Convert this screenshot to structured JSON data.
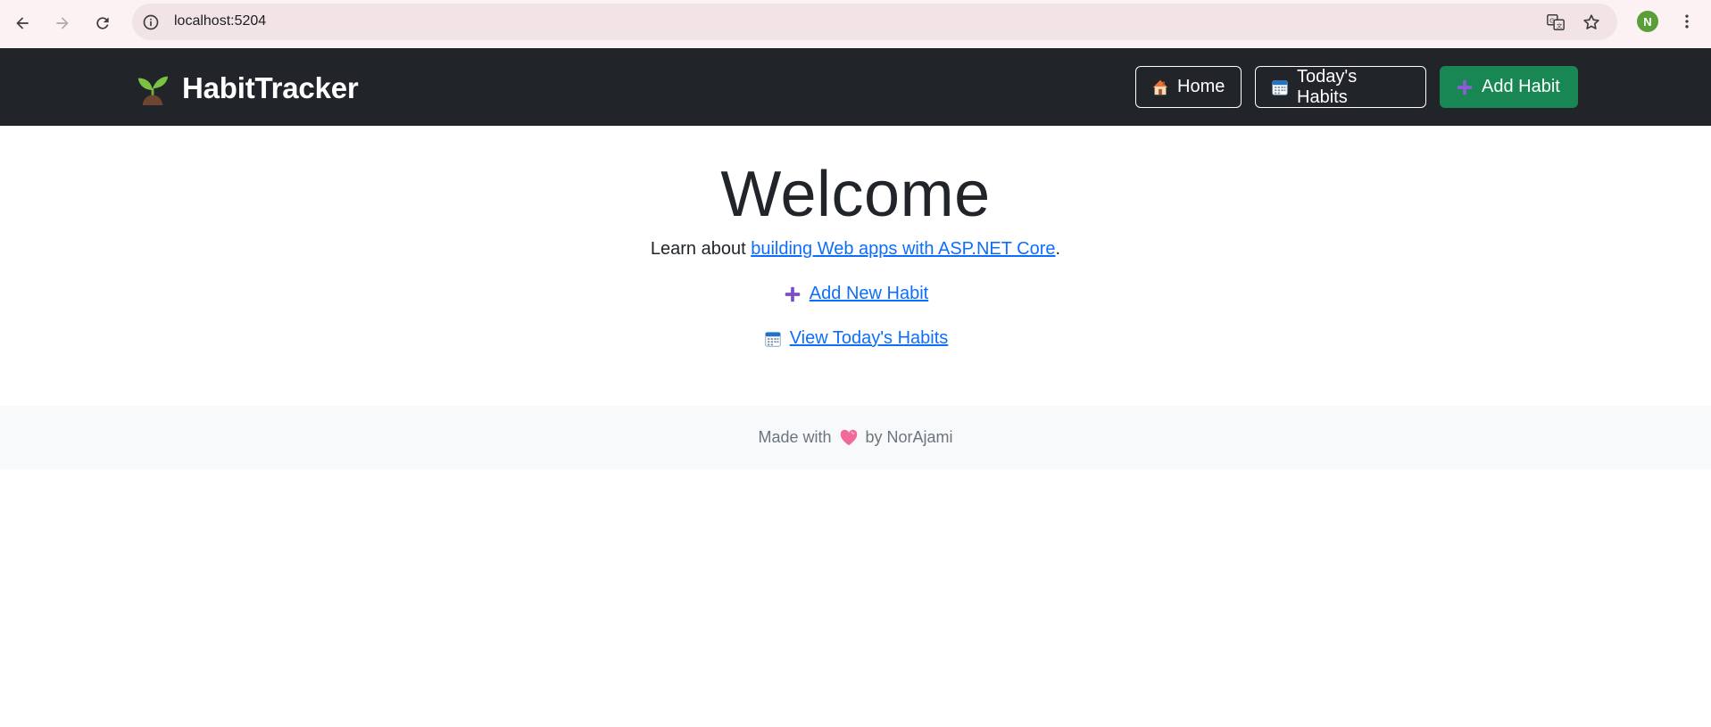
{
  "browser": {
    "url": "localhost:5204"
  },
  "navbar": {
    "brand": "HabitTracker",
    "buttons": {
      "home": "Home",
      "today": "Today's Habits",
      "add": "Add Habit"
    }
  },
  "main": {
    "title": "Welcome",
    "learn_prefix": "Learn about ",
    "learn_link": "building Web apps with ASP.NET Core",
    "learn_suffix": ".",
    "add_new_habit": "Add New Habit",
    "view_today": "View Today's Habits"
  },
  "footer": {
    "prefix": "Made with",
    "suffix": "by NorAjami"
  },
  "profile": {
    "initial": "N"
  },
  "colors": {
    "navbar_bg": "#212529",
    "success": "#198754",
    "link": "#0d6efd",
    "footer_bg": "#f8f9fa"
  },
  "icons": {
    "brand": "sprout-icon",
    "home": "house-icon",
    "today": "calendar-icon",
    "add": "plus-icon",
    "footer": "heart-icon"
  }
}
